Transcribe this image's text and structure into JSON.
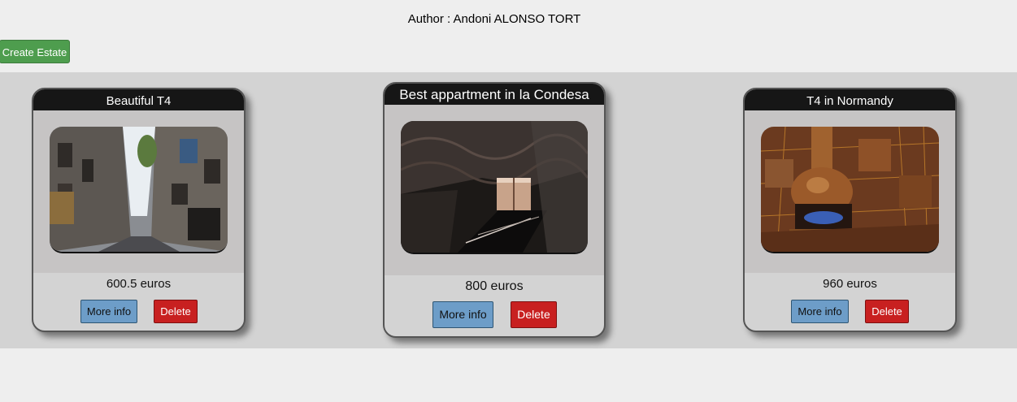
{
  "header": {
    "author": "Author : Andoni ALONSO TORT"
  },
  "toolbar": {
    "create_label": "Create Estate"
  },
  "estates": [
    {
      "title": "Beautiful T4",
      "price": "600.5 euros",
      "image": "narrow-street-photo",
      "more_info_label": "More info",
      "delete_label": "Delete"
    },
    {
      "title": "Best appartment in la Condesa",
      "price": "800 euros",
      "image": "dark-staircase-photo",
      "more_info_label": "More info",
      "delete_label": "Delete"
    },
    {
      "title": "T4 in Normandy",
      "price": "960 euros",
      "image": "copper-fireplace-photo",
      "more_info_label": "More info",
      "delete_label": "Delete"
    }
  ],
  "colors": {
    "create": "#4e9d4e",
    "info": "#6d9dc8",
    "delete": "#c82020",
    "card_header": "#161616",
    "band": "#d3d3d3"
  }
}
